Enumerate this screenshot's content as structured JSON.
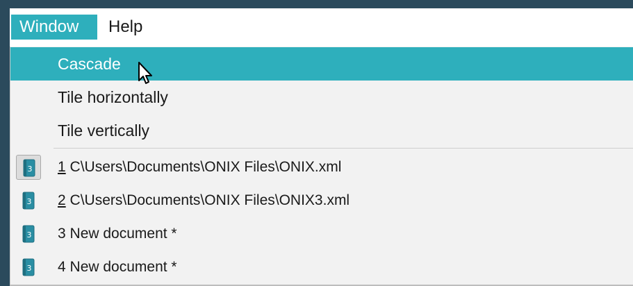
{
  "menubar": {
    "items": [
      {
        "label": "Window"
      },
      {
        "label": "Help"
      }
    ]
  },
  "window_menu": {
    "items": [
      {
        "label": "Cascade"
      },
      {
        "label": "Tile horizontally"
      },
      {
        "label": "Tile vertically"
      }
    ],
    "documents": [
      {
        "number": "1",
        "label": " C\\Users\\Documents\\ONIX Files\\ONIX.xml",
        "checked": true
      },
      {
        "number": "2",
        "label": " C\\Users\\Documents\\ONIX Files\\ONIX3.xml",
        "checked": false
      },
      {
        "number": "3",
        "label": " New document *",
        "checked": false
      },
      {
        "number": "4",
        "label": " New document *",
        "checked": false
      }
    ]
  },
  "icons": {
    "document": "onix-document-icon",
    "cursor": "mouse-pointer-icon"
  },
  "colors": {
    "accent": "#2eafbc",
    "frame": "#2b4a5c",
    "menu_background": "#f2f2f2"
  }
}
